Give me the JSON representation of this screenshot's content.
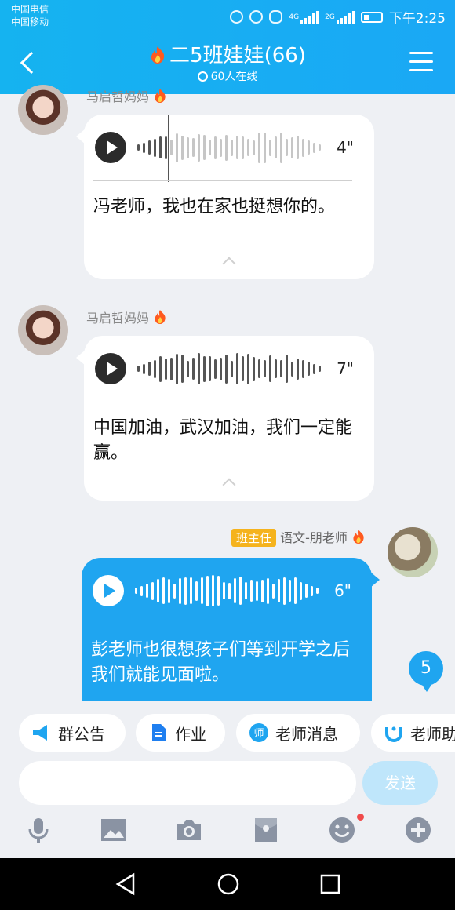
{
  "status": {
    "carrier1": "中国电信",
    "carrier2": "中国移动",
    "net1": "4G",
    "net2": "2G",
    "time": "下午2:25"
  },
  "header": {
    "title": "二5班娃娃(66)",
    "online": "60人在线"
  },
  "messages": [
    {
      "sender": "马启哲妈妈",
      "duration": "4\"",
      "text": "冯老师，我也在家也挺想你的。"
    },
    {
      "sender": "马启哲妈妈",
      "duration": "7\"",
      "text": "中国加油，武汉加油，我们一定能赢。"
    },
    {
      "role": "班主任",
      "sender": "语文-朋老师",
      "duration": "6\"",
      "text": "彭老师也很想孩子们等到开学之后我们就能见面啦。"
    }
  ],
  "unread_count": "5",
  "quick_actions": [
    "群公告",
    "作业",
    "老师消息",
    "老师助"
  ],
  "send_label": "发送",
  "colors": {
    "brand": "#1aa8f5",
    "bubble_self": "#1fa5f0",
    "role_badge": "#f5b31d"
  },
  "icons": [
    "back-icon",
    "menu-icon",
    "play-icon",
    "mic-icon",
    "image-icon",
    "camera-icon",
    "redpacket-icon",
    "emoji-icon",
    "plus-icon"
  ]
}
